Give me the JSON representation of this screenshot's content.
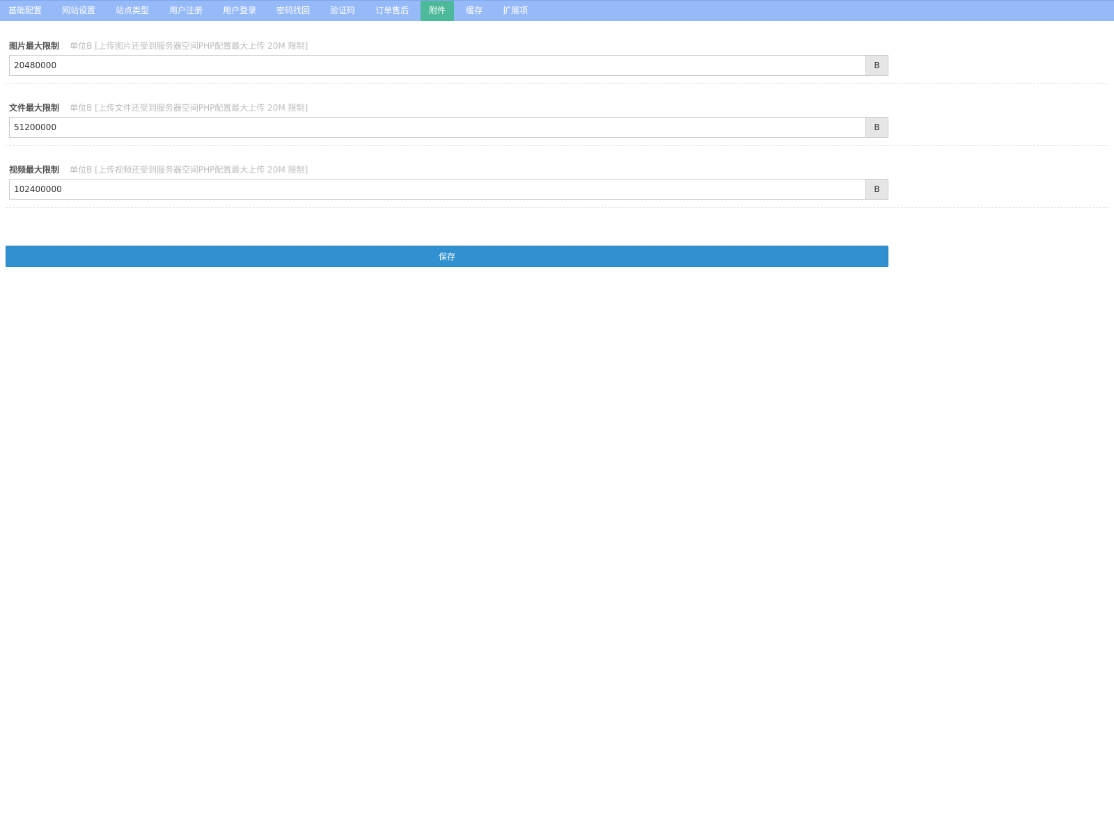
{
  "tabs": [
    {
      "label": "基础配置"
    },
    {
      "label": "网站设置"
    },
    {
      "label": "站点类型"
    },
    {
      "label": "用户注册"
    },
    {
      "label": "用户登录"
    },
    {
      "label": "密码找回"
    },
    {
      "label": "验证码"
    },
    {
      "label": "订单售后"
    },
    {
      "label": "附件",
      "active": true
    },
    {
      "label": "缓存"
    },
    {
      "label": "扩展项"
    }
  ],
  "fields": [
    {
      "label": "图片最大限制",
      "hint": "单位B [上传图片还受到服务器空间PHP配置最大上传 20M 限制]",
      "value": "20480000",
      "unit": "B"
    },
    {
      "label": "文件最大限制",
      "hint": "单位B [上传文件还受到服务器空间PHP配置最大上传 20M 限制]",
      "value": "51200000",
      "unit": "B"
    },
    {
      "label": "视频最大限制",
      "hint": "单位B [上传视频还受到服务器空间PHP配置最大上传 20M 限制]",
      "value": "102400000",
      "unit": "B"
    }
  ],
  "save_label": "保存",
  "colors": {
    "tabbar_bg": "#96b9f8",
    "tab_active_bg": "#4cb99a",
    "save_button_bg": "#3090d0"
  }
}
